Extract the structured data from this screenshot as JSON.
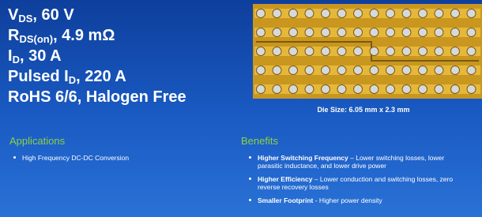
{
  "specs": [
    {
      "main": "V",
      "sub": "DS",
      "rest": ", 60 V"
    },
    {
      "main": "R",
      "sub": "DS(on)",
      "rest": ", 4.9 mΩ"
    },
    {
      "main": "I",
      "sub": "D",
      "rest": ", 30 A"
    },
    {
      "main": "Pulsed I",
      "sub": "D",
      "rest": ", 220 A"
    },
    {
      "main": "RoHS 6/6, Halogen Free",
      "sub": "",
      "rest": ""
    }
  ],
  "die": {
    "caption": "Die Size: 6.05 mm x 2.3 mm",
    "colors": {
      "background": "#c9961f",
      "trace": "#e6b83a",
      "bump": "#d6d9dc",
      "bump_rim": "#7a5a10"
    }
  },
  "applications": {
    "title": "Applications",
    "items": [
      "High Frequency DC-DC Conversion"
    ]
  },
  "benefits": {
    "title": "Benefits",
    "items": [
      {
        "bold": "Higher Switching Frequency",
        "text": " – Lower switching losses, lower parasitic inductance, and lower drive power"
      },
      {
        "bold": "Higher Efficiency",
        "text": " – Lower conduction and switching losses, zero reverse recovery losses"
      },
      {
        "bold": "Smaller Footprint",
        "text": " - Higher power density"
      }
    ]
  },
  "colors": {
    "heading_green": "#8fd13f",
    "background_top": "#0e3f9c",
    "background_bottom": "#2a72d6"
  }
}
